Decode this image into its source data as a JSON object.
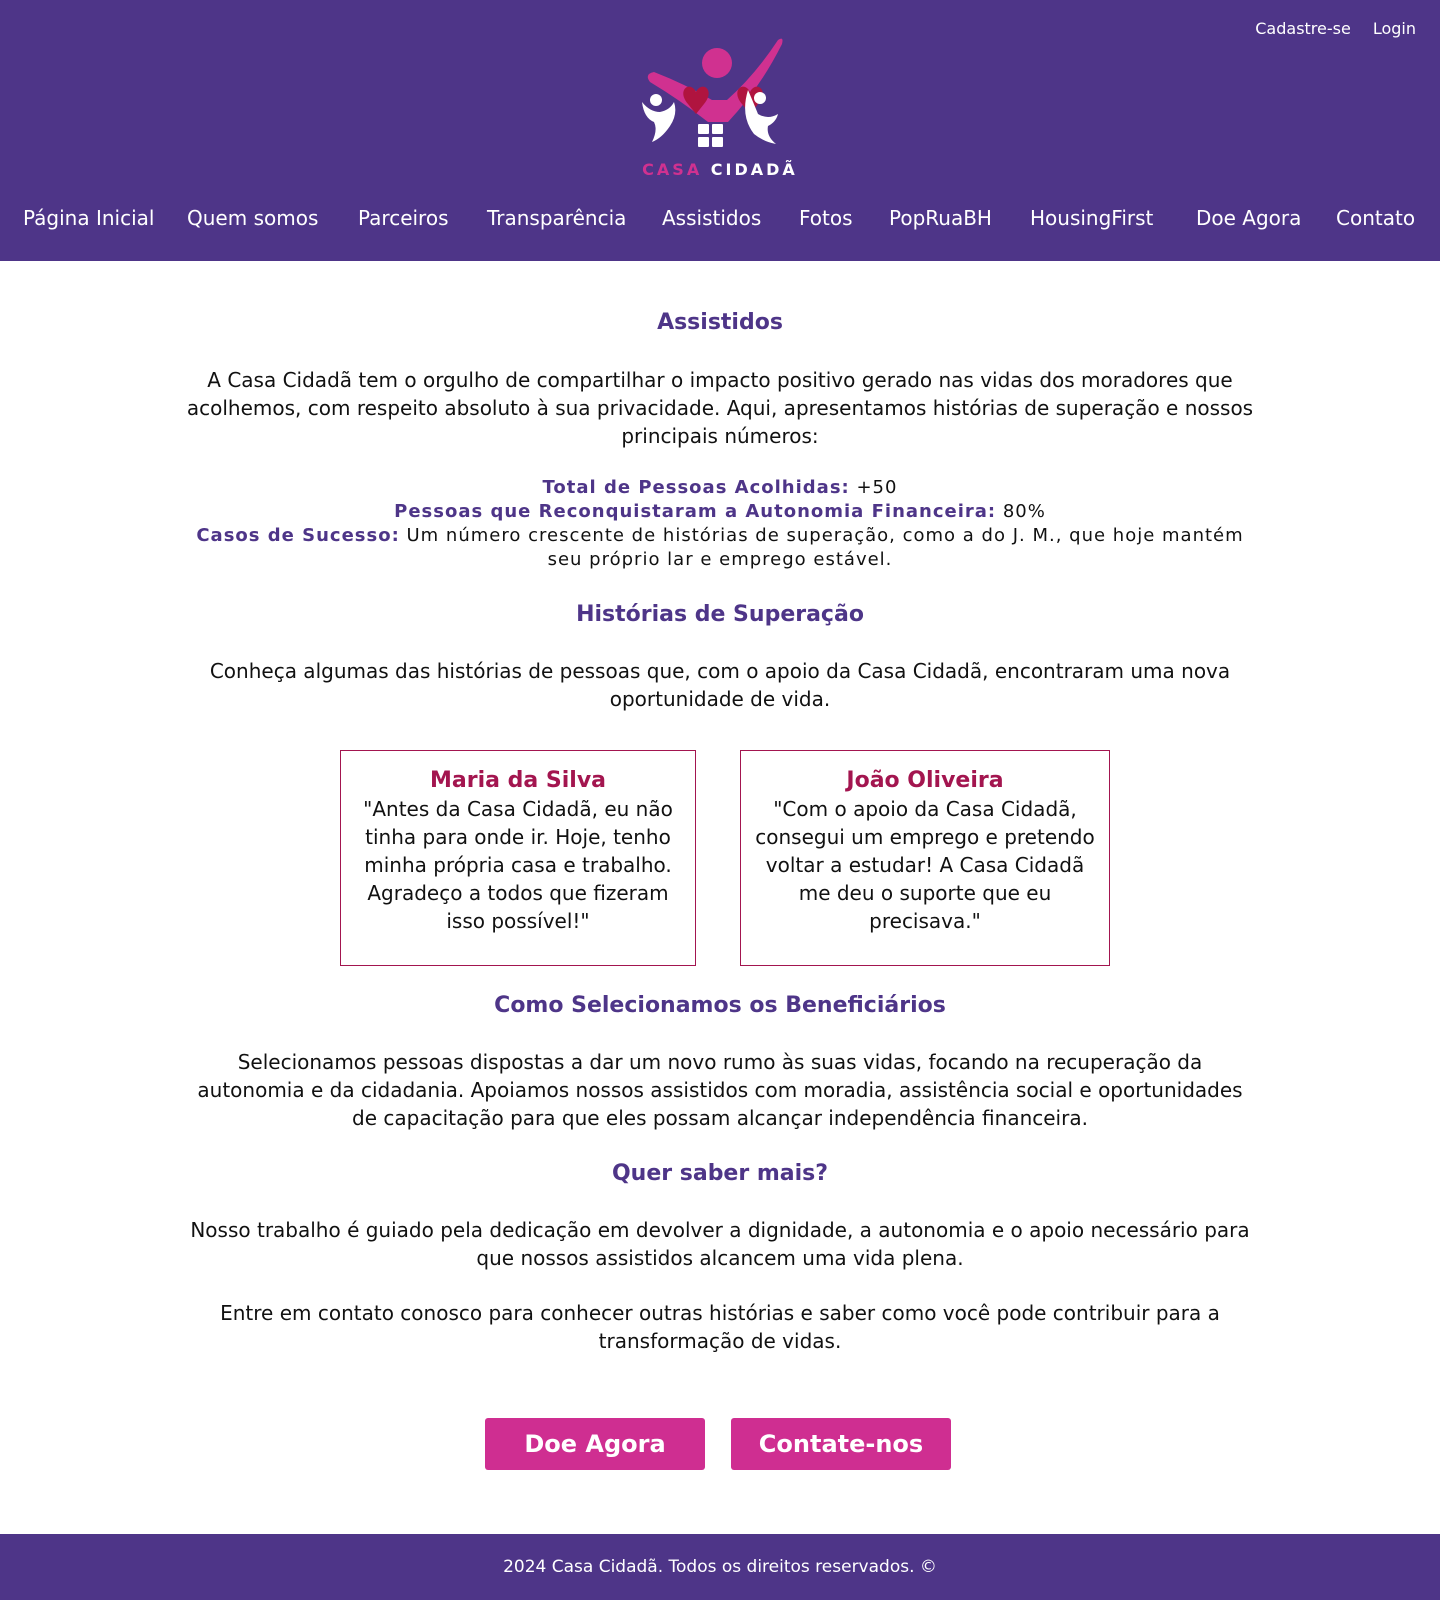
{
  "header": {
    "auth": {
      "signup": "Cadastre-se",
      "login": "Login"
    },
    "logo": {
      "word1": "CASA",
      "word2": "CIDADÃ"
    },
    "nav": [
      "Página Inicial",
      "Quem somos",
      "Parceiros",
      "Transparência",
      "Assistidos",
      "Fotos",
      "PopRuaBH",
      "HousingFirst",
      "Doe Agora",
      "Contato"
    ]
  },
  "main": {
    "title": "Assistidos",
    "intro": "A Casa Cidadã tem o orgulho de compartilhar o impacto positivo gerado nas vidas dos moradores que acolhemos, com respeito absoluto à sua privacidade. Aqui, apresentamos histórias de superação e nossos principais números:",
    "stats": [
      {
        "label": "Total de Pessoas Acolhidas:",
        "value": " +50"
      },
      {
        "label": "Pessoas que Reconquistaram a Autonomia Financeira:",
        "value": " 80%"
      },
      {
        "label": "Casos de Sucesso:",
        "value": " Um número crescente de histórias de superação, como a do J. M., que hoje mantém seu próprio lar e emprego estável."
      }
    ],
    "stories_title": "Histórias de Superação",
    "stories_intro": "Conheça algumas das histórias de pessoas que, com o apoio da Casa Cidadã, encontraram uma nova oportunidade de vida.",
    "stories": [
      {
        "name": "Maria da Silva",
        "quote": "\"Antes da Casa Cidadã, eu não tinha para onde ir. Hoje, tenho minha própria casa e trabalho. Agradeço a todos que fizeram isso possível!\""
      },
      {
        "name": "João Oliveira",
        "quote": "\"Com o apoio da Casa Cidadã, consegui um emprego e pretendo voltar a estudar! A Casa Cidadã me deu o suporte que eu precisava.\""
      }
    ],
    "selection_title": "Como Selecionamos os Beneficiários",
    "selection_text": "Selecionamos pessoas dispostas a dar um novo rumo às suas vidas, focando na recuperação da autonomia e da cidadania. Apoiamos nossos assistidos com moradia, assistência social e oportunidades de capacitação para que eles possam alcançar independência financeira.",
    "more_title": "Quer saber mais?",
    "more_text1": "Nosso trabalho é guiado pela dedicação em devolver a dignidade, a autonomia e o apoio necessário para que nossos assistidos alcancem uma vida plena.",
    "more_text2": "Entre em contato conosco para conhecer outras histórias e saber como você pode contribuir para a transformação de vidas.",
    "buttons": {
      "donate": "Doe Agora",
      "contact": "Contate-nos"
    }
  },
  "footer": {
    "text": "2024 Casa Cidadã. Todos os direitos reservados. ©"
  },
  "colors": {
    "brand_purple": "#4e3588",
    "accent_pink": "#cf2e91",
    "card_crimson": "#a3154f"
  }
}
